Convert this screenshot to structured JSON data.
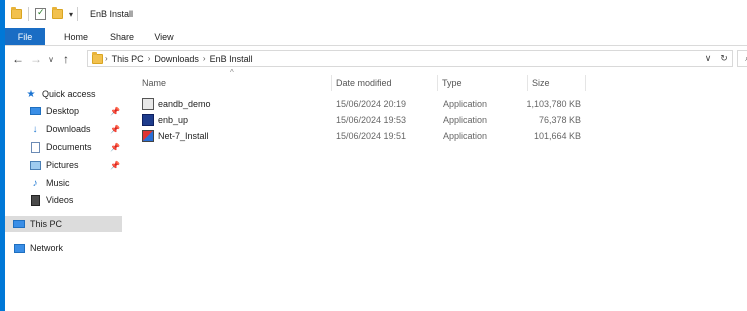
{
  "window": {
    "title": "EnB Install"
  },
  "ribbon": {
    "tabs": [
      "File",
      "Home",
      "Share",
      "View"
    ]
  },
  "address": {
    "crumbs": [
      "This PC",
      "Downloads",
      "EnB Install"
    ]
  },
  "nav": {
    "quick_access": "Quick access",
    "items": [
      {
        "label": "Desktop",
        "pinned": true
      },
      {
        "label": "Downloads",
        "pinned": true
      },
      {
        "label": "Documents",
        "pinned": true
      },
      {
        "label": "Pictures",
        "pinned": true
      },
      {
        "label": "Music",
        "pinned": false
      },
      {
        "label": "Videos",
        "pinned": false
      }
    ],
    "this_pc": "This PC",
    "network": "Network"
  },
  "columns": {
    "name": "Name",
    "date": "Date modified",
    "type": "Type",
    "size": "Size"
  },
  "files": [
    {
      "name": "eandb_demo",
      "date": "15/06/2024 20:19",
      "type": "Application",
      "size": "1,103,780 KB"
    },
    {
      "name": "enb_up",
      "date": "15/06/2024 19:53",
      "type": "Application",
      "size": "76,378 KB"
    },
    {
      "name": "Net-7_Install",
      "date": "15/06/2024 19:51",
      "type": "Application",
      "size": "101,664 KB"
    }
  ],
  "colors": {
    "accent": "#0078d7",
    "file_tab": "#1a6dc4",
    "selected_nav": "#dcdcdc"
  }
}
